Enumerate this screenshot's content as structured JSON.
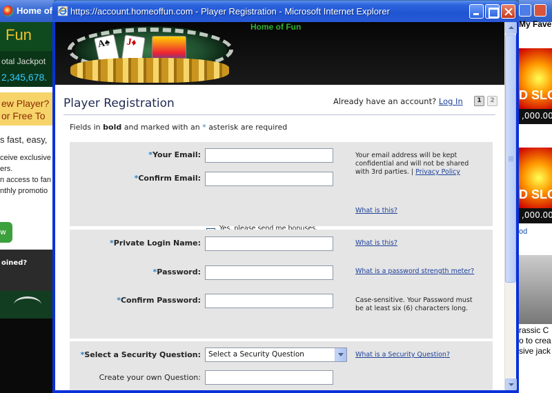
{
  "background_left": {
    "title": "Home of",
    "brand": "Fun",
    "jackpot_label": "otal Jackpot",
    "jackpot_value": "2,345,678.",
    "new_player_1": "ew Player?",
    "new_player_2": "or Free To",
    "line_big": "s fast, easy,",
    "line_1": "ceive exclusive",
    "line_2": "ers.",
    "line_3": "n access to fan",
    "line_4": "nthly promotio",
    "go_label": "w",
    "joined": "oined?"
  },
  "background_right": {
    "favorites": "My Fave",
    "slot_label": "D SLO",
    "slot_amount_1": ",000.00",
    "slot_amount_2": ",000.00",
    "od": "od",
    "text_1": "rassic C",
    "text_2": "o to crea",
    "text_3": "sive jack"
  },
  "window": {
    "title": "https://account.homeoffun.com - Player Registration - Microsoft Internet Explorer"
  },
  "banner": {
    "site_name": "Home of Fun",
    "card_1": "A♠",
    "card_2": "J♦"
  },
  "header": {
    "title": "Player Registration",
    "account_prompt": "Already have an account?",
    "login_link": "Log In",
    "steps": [
      "1",
      "2"
    ]
  },
  "required_note": {
    "prefix": "Fields in",
    "bold": "bold",
    "middle": "and marked with an",
    "asterisk": "*",
    "suffix": "asterisk are required"
  },
  "form": {
    "email_label": "Your Email:",
    "confirm_email_label": "Confirm Email:",
    "email_help": "Your email address will be kept confidential and will not be shared with 3rd parties. |",
    "privacy_link": "Privacy Policy",
    "bonus_checkbox_label": "Yes, please send me bonuses, promotions and news via email.",
    "bonus_checked": true,
    "bonus_help_link": "What is this?",
    "login_name_label": "Private Login Name:",
    "login_name_help_link": "What is this?",
    "password_label": "Password:",
    "password_help_link": "What is a password strength meter?",
    "confirm_password_label": "Confirm Password:",
    "password_help": "Case-sensitive. Your Password must be at least six (6) characters long.",
    "security_question_label": "Select a Security Question:",
    "security_question_value": "Select a Security Question",
    "security_question_help_link": "What is a Security Question?",
    "own_question_label": "Create your own Question:",
    "required_marker": "*"
  }
}
